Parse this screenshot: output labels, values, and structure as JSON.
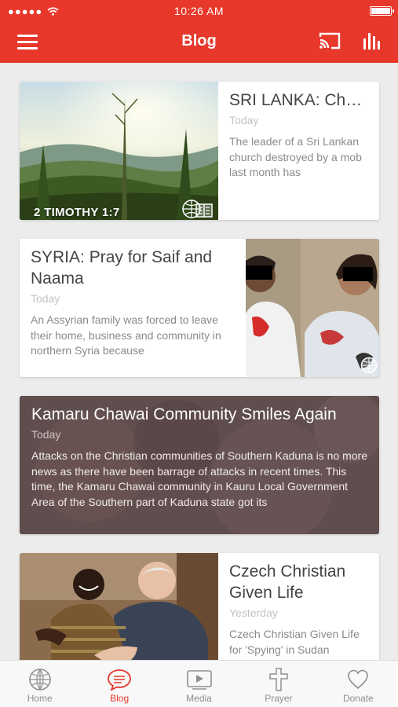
{
  "status_bar": {
    "signal": "●●●●●",
    "time": "10:26 AM",
    "icons": [
      "signal-dots-icon",
      "wifi-icon",
      "battery-icon"
    ]
  },
  "app_bar": {
    "title": "Blog",
    "icons": [
      "menu-icon",
      "cast-icon",
      "bar-chart-icon"
    ]
  },
  "posts": [
    {
      "title": "SRI LANKA: Church Contin...",
      "date": "Today",
      "excerpt": "The leader of a Sri Lankan church destroyed by a mob last month has",
      "image_caption": "2 TIMOTHY 1:7",
      "image_badge": "globe-bible-icon"
    },
    {
      "title": "SYRIA: Pray for Saif and Naama",
      "date": "Today",
      "excerpt": "An Assyrian family was forced to leave their home, business and community in northern Syria because",
      "image_badge": "globe-icon"
    },
    {
      "title": "Kamaru Chawai Community Smiles Again",
      "date": "Today",
      "excerpt": "Attacks on the Christian communities of Southern Kaduna is no more news as there have been barrage of attacks in recent times. This time, the Kamaru Chawai community in Kauru Local Government Area of the Southern part of Kaduna state got its"
    },
    {
      "title": "Czech Christian Given Life",
      "date": "Yesterday",
      "excerpt": "Czech Christian Given Life for 'Spying' in Sudan"
    }
  ],
  "tabs": [
    {
      "label": "Home",
      "icon": "globe-icon",
      "active": false
    },
    {
      "label": "Blog",
      "icon": "speech-bubble-icon",
      "active": true
    },
    {
      "label": "Media",
      "icon": "video-player-icon",
      "active": false
    },
    {
      "label": "Prayer",
      "icon": "cross-icon",
      "active": false
    },
    {
      "label": "Donate",
      "icon": "heart-icon",
      "active": false
    }
  ],
  "colors": {
    "accent": "#e8372b",
    "background": "#ececec",
    "card": "#ffffff",
    "title_text": "#444444",
    "date_text": "#c2c2c2",
    "excerpt_text": "#8a8a8a",
    "tab_inactive": "#8f8f8f"
  }
}
